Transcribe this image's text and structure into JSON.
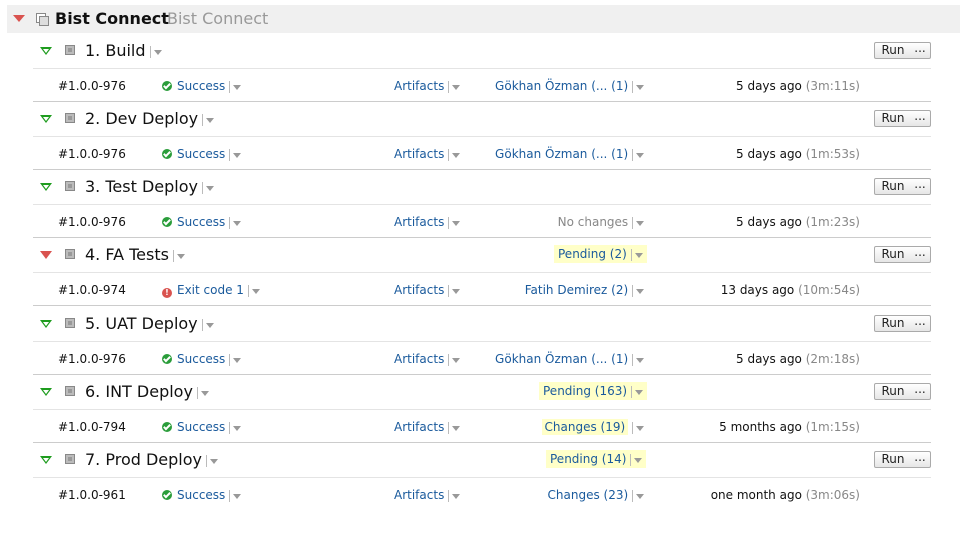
{
  "project": {
    "name": "Bist Connect",
    "description": "Bist Connect"
  },
  "colors": {
    "success": "#2a9d3a",
    "failure": "#d9534f",
    "link": "#1a5a9c",
    "highlight": "#ffffc8"
  },
  "run_label": "Run",
  "more_label": "...",
  "build_configs": [
    {
      "name": "1. Build",
      "status": "expanded",
      "pending": "",
      "build": {
        "number": "#1.0.0-976",
        "status_icon": "success-icon",
        "status": "Success",
        "artifacts": "Artifacts",
        "changes": "Gökhan Özman (... (1)",
        "changes_style": "link",
        "time": "5 days ago",
        "duration": "(3m:11s)"
      }
    },
    {
      "name": "2. Dev Deploy",
      "status": "expanded",
      "pending": "",
      "build": {
        "number": "#1.0.0-976",
        "status_icon": "success-icon",
        "status": "Success",
        "artifacts": "Artifacts",
        "changes": "Gökhan Özman (... (1)",
        "changes_style": "link",
        "time": "5 days ago",
        "duration": "(1m:53s)"
      }
    },
    {
      "name": "3. Test Deploy",
      "status": "expanded",
      "pending": "",
      "build": {
        "number": "#1.0.0-976",
        "status_icon": "success-icon",
        "status": "Success",
        "artifacts": "Artifacts",
        "changes": "No changes",
        "changes_style": "none",
        "time": "5 days ago",
        "duration": "(1m:23s)"
      }
    },
    {
      "name": "4. FA Tests",
      "status": "failed",
      "pending": "Pending (2)",
      "build": {
        "number": "#1.0.0-974",
        "status_icon": "error-icon",
        "status": "Exit code 1",
        "artifacts": "Artifacts",
        "changes": "Fatih Demirez (2)",
        "changes_style": "link",
        "time": "13 days ago",
        "duration": "(10m:54s)"
      }
    },
    {
      "name": "5. UAT Deploy",
      "status": "expanded",
      "pending": "",
      "build": {
        "number": "#1.0.0-976",
        "status_icon": "success-icon",
        "status": "Success",
        "artifacts": "Artifacts",
        "changes": "Gökhan Özman (... (1)",
        "changes_style": "link",
        "time": "5 days ago",
        "duration": "(2m:18s)"
      }
    },
    {
      "name": "6. INT Deploy",
      "status": "expanded",
      "pending": "Pending (163)",
      "build": {
        "number": "#1.0.0-794",
        "status_icon": "success-icon",
        "status": "Success",
        "artifacts": "Artifacts",
        "changes": "Changes (19)",
        "changes_style": "highlight",
        "time": "5 months ago",
        "duration": "(1m:15s)"
      }
    },
    {
      "name": "7. Prod Deploy",
      "status": "expanded",
      "pending": "Pending (14)",
      "build": {
        "number": "#1.0.0-961",
        "status_icon": "success-icon",
        "status": "Success",
        "artifacts": "Artifacts",
        "changes": "Changes (23)",
        "changes_style": "plain-link",
        "time": "one month ago",
        "duration": "(3m:06s)"
      }
    }
  ]
}
